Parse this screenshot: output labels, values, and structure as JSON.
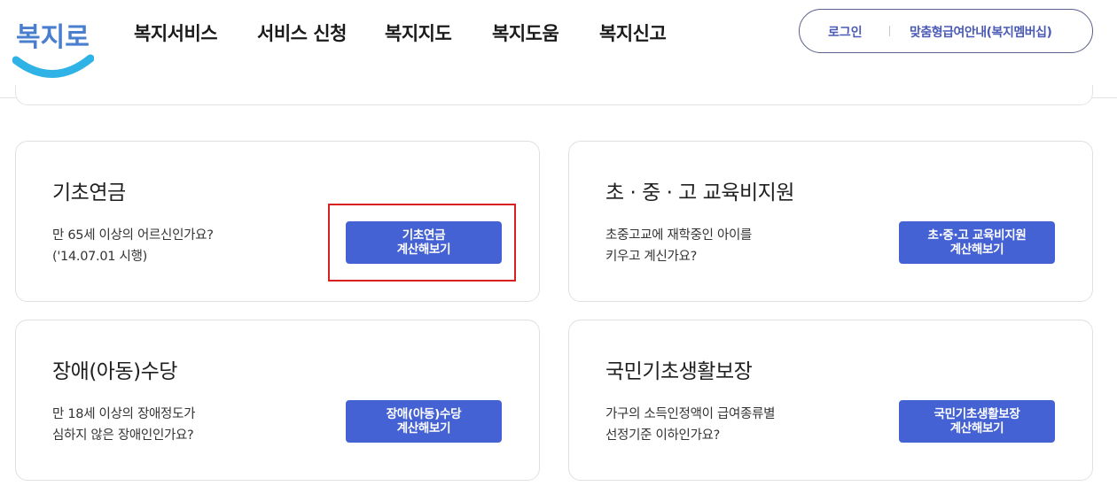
{
  "logo": {
    "text": "복지로",
    "color_text": "#4a7fcf",
    "color_smile": "#2fb3e6"
  },
  "nav": [
    {
      "label": "복지서비스"
    },
    {
      "label": "서비스 신청"
    },
    {
      "label": "복지지도"
    },
    {
      "label": "복지도움"
    },
    {
      "label": "복지신고"
    }
  ],
  "member": {
    "login": "로그인",
    "custom": "맞춤형급여안내(복지멤버십)"
  },
  "cards": [
    {
      "title": "기초연금",
      "desc1": "만 65세 이상의 어르신인가요?",
      "desc2": "('14.07.01 시행)",
      "btn1": "기초연금",
      "btn2": "계산해보기"
    },
    {
      "title": "초 · 중 · 고 교육비지원",
      "desc1": "초중고교에 재학중인 아이를",
      "desc2": "키우고 계신가요?",
      "btn1": "초·중·고 교육비지원",
      "btn2": "계산해보기"
    },
    {
      "title": "장애(아동)수당",
      "desc1": "만 18세 이상의 장애정도가",
      "desc2": "심하지 않은 장애인인가요?",
      "btn1": "장애(아동)수당",
      "btn2": "계산해보기"
    },
    {
      "title": "국민기초생활보장",
      "desc1": "가구의 소득인정액이 급여종류별",
      "desc2": "선정기준 이하인가요?",
      "btn1": "국민기초생활보장",
      "btn2": "계산해보기"
    }
  ],
  "colors": {
    "button": "#4562d4",
    "accent_text": "#4b5bb5",
    "highlight": "#d82020"
  }
}
